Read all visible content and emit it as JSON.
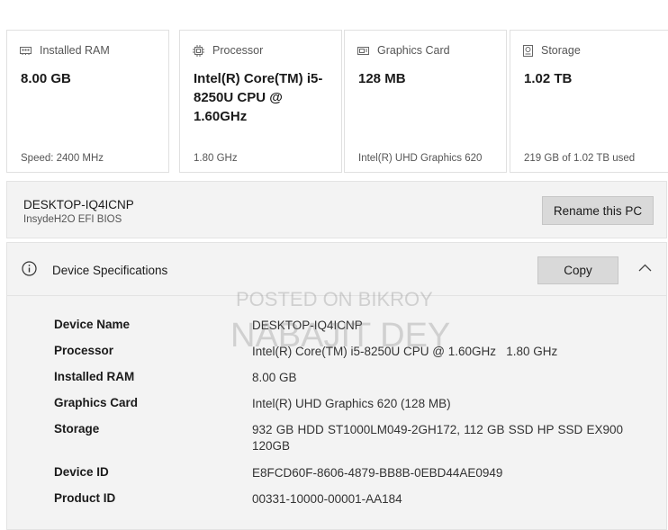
{
  "cards": [
    {
      "title": "Installed RAM",
      "value": "8.00 GB",
      "sub": "Speed: 2400 MHz",
      "icon": "memory-icon"
    },
    {
      "title": "Processor",
      "value": "Intel(R) Core(TM) i5-8250U CPU @ 1.60GHz",
      "sub": "1.80 GHz",
      "icon": "processor-icon"
    },
    {
      "title": "Graphics Card",
      "value": "128 MB",
      "sub": "Intel(R) UHD Graphics 620",
      "icon": "graphics-card-icon"
    },
    {
      "title": "Storage",
      "value": "1.02 TB",
      "sub": "219 GB of 1.02 TB used",
      "icon": "storage-icon"
    }
  ],
  "pc": {
    "name": "DESKTOP-IQ4ICNP",
    "bios": "InsydeH2O EFI BIOS",
    "rename_label": "Rename this PC"
  },
  "specs": {
    "title": "Device Specifications",
    "copy_label": "Copy",
    "rows": [
      {
        "key": "Device Name",
        "value": "DESKTOP-IQ4ICNP"
      },
      {
        "key": "Processor",
        "value": "Intel(R) Core(TM) i5-8250U CPU @ 1.60GHz   1.80 GHz"
      },
      {
        "key": "Installed RAM",
        "value": "8.00 GB"
      },
      {
        "key": "Graphics Card",
        "value": "Intel(R) UHD Graphics 620 (128 MB)"
      },
      {
        "key": "Storage",
        "value": "932 GB HDD ST1000LM049-2GH172, 112 GB SSD HP SSD EX900 120GB"
      },
      {
        "key": "Device ID",
        "value": "E8FCD60F-8606-4879-BB8B-0EBD44AE0949"
      },
      {
        "key": "Product ID",
        "value": "00331-10000-00001-AA184"
      }
    ]
  },
  "watermark": {
    "line1": "POSTED ON BIKROY",
    "line2": "NABAJIT DEY"
  }
}
